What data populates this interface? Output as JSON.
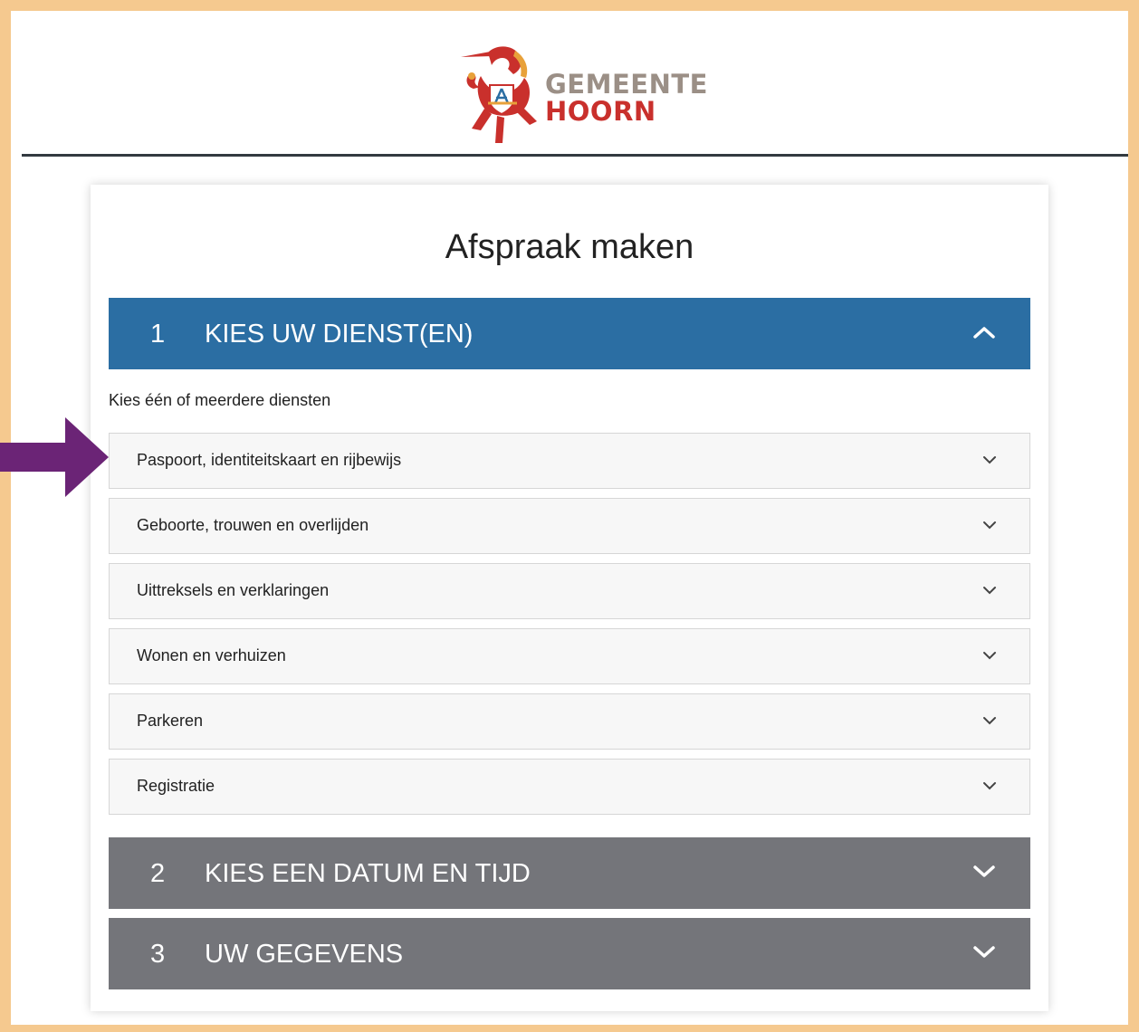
{
  "brand": {
    "line1": "GEMEENTE",
    "line2": "HOORN",
    "colors": {
      "grey": "#9b8f86",
      "red": "#c9302c"
    }
  },
  "page": {
    "title": "Afspraak maken"
  },
  "steps": [
    {
      "number": "1",
      "label": "KIES UW DIENST(EN)",
      "state": "expanded",
      "color": "#2b6ea3",
      "icon": "chevron-up-icon"
    },
    {
      "number": "2",
      "label": "KIES EEN DATUM EN TIJD",
      "state": "collapsed",
      "color": "#74757a",
      "icon": "chevron-down-icon"
    },
    {
      "number": "3",
      "label": "UW GEGEVENS",
      "state": "collapsed",
      "color": "#74757a",
      "icon": "chevron-down-icon"
    }
  ],
  "services": {
    "intro": "Kies één of meerdere diensten",
    "items": [
      {
        "label": "Paspoort, identiteitskaart en rijbewijs"
      },
      {
        "label": "Geboorte, trouwen en overlijden"
      },
      {
        "label": "Uittreksels en verklaringen"
      },
      {
        "label": "Wonen en verhuizen"
      },
      {
        "label": "Parkeren"
      },
      {
        "label": "Registratie"
      }
    ]
  },
  "annotation": {
    "icon": "arrow-right-icon",
    "color": "#6b2476"
  }
}
